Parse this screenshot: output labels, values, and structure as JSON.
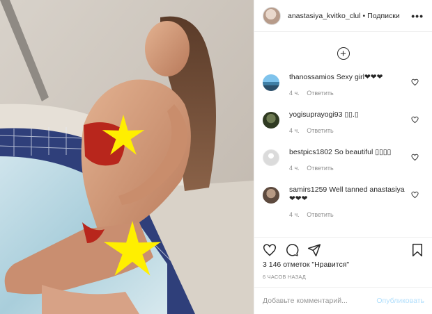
{
  "post": {
    "author": "anastasiya_kvitko_clul",
    "separator": "•",
    "follow_label": "Подписки",
    "more_label": "•••"
  },
  "icons": {
    "add": "plus-circle-icon",
    "like": "heart-icon",
    "comment": "comment-bubble-icon",
    "share": "paper-plane-icon",
    "save": "bookmark-icon"
  },
  "comments": [
    {
      "username": "thanossamios",
      "text": "Sexy girl❤❤❤",
      "age": "4 ч.",
      "reply_label": "Ответить"
    },
    {
      "username": "yogisuprayogi93",
      "text": "▯▯.▯",
      "age": "4 ч.",
      "reply_label": "Ответить"
    },
    {
      "username": "bestpics1802",
      "text": "So beautiful ▯▯▯▯",
      "age": "4 ч.",
      "reply_label": "Ответить"
    },
    {
      "username": "samirs1259",
      "text": "Well tanned anastasiya❤❤❤",
      "age": "4 ч.",
      "reply_label": "Ответить"
    }
  ],
  "stats": {
    "likes": "3 146 отметок \"Нравится\"",
    "posted": "6 ЧАСОВ НАЗАД"
  },
  "composer": {
    "placeholder": "Добавьте комментарий...",
    "post_label": "Опубликовать"
  },
  "colors": {
    "text": "#262626",
    "muted": "#8e8e8e",
    "divider": "#efefef",
    "post_disabled": "#b2dffc",
    "censor_star": "#ffef00"
  }
}
